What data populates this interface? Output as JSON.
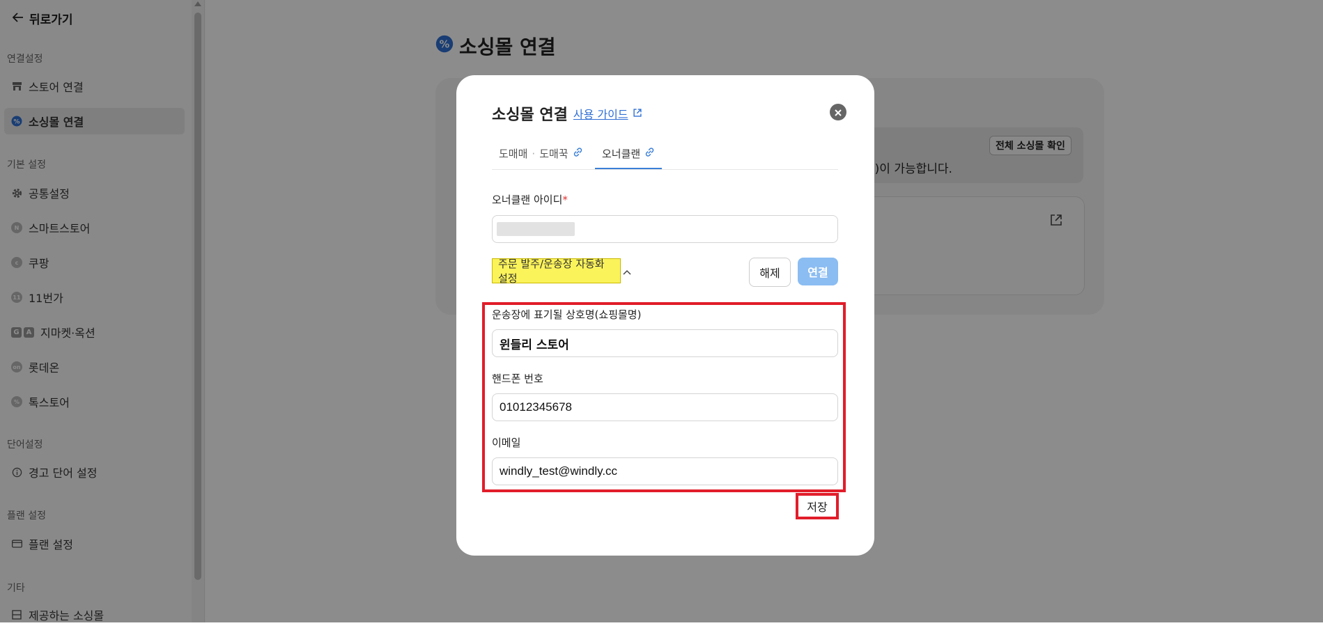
{
  "sidebar": {
    "back_label": "뒤로가기",
    "sections": {
      "connection": "연결설정",
      "basic": "기본 설정",
      "words": "단어설정",
      "plan": "플랜 설정",
      "etc": "기타"
    },
    "items": {
      "store_connect": "스토어 연결",
      "sourcing_connect": "소싱몰 연결",
      "common_settings": "공통설정",
      "smartstore": "스마트스토어",
      "coupang": "쿠팡",
      "st11": "11번가",
      "gmarket": "지마켓·옥션",
      "lotteon": "롯데온",
      "toss": "톡스토어",
      "warning_words": "경고 단어 설정",
      "plan_settings": "플랜 설정",
      "provided_malls": "제공하는 소싱몰"
    },
    "active_item": "sourcing_connect"
  },
  "page": {
    "title": "소싱몰 연결",
    "notice_text": "럽)이 가능합니다.",
    "all_malls_button": "전체 소싱몰 확인"
  },
  "modal": {
    "title": "소싱몰 연결",
    "guide_link": "사용 가이드",
    "tabs": [
      {
        "label_a": "도매매",
        "separator": "·",
        "label_b": "도매꾹"
      },
      {
        "label": "오너클랜",
        "active": true
      }
    ],
    "owner_id_label": "오너클랜 아이디",
    "required_mark": "*",
    "auto_toggle_label": "주문 발주/운송장 자동화 설정",
    "release_button": "해제",
    "connect_button": "연결",
    "fields": {
      "shop_name_label": "운송장에 표기될 상호명(쇼핑몰명)",
      "shop_name_value": "윈들리 스토어",
      "phone_label": "핸드폰 번호",
      "phone_value": "01012345678",
      "email_label": "이메일",
      "email_value": "windly_test@windly.cc"
    },
    "save_button": "저장"
  },
  "colors": {
    "accent": "#3b7fd6",
    "connect_button": "#8bbcf2",
    "highlight": "#fbf35a",
    "annotation_red": "#e11d2a"
  }
}
